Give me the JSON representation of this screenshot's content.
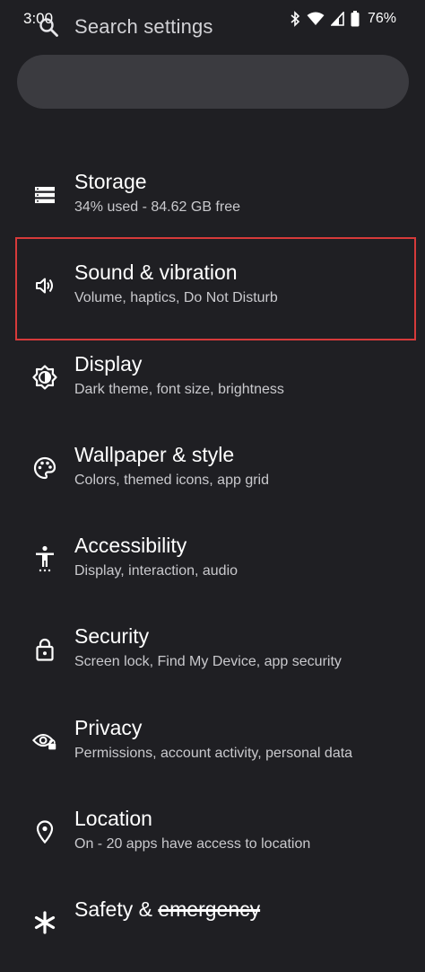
{
  "status_bar": {
    "time": "3:00",
    "battery_percent": "76%"
  },
  "search": {
    "placeholder": "Search settings"
  },
  "settings": [
    {
      "title": "Storage",
      "subtitle": "34% used - 84.62 GB free",
      "icon": "storage-icon"
    },
    {
      "title": "Sound & vibration",
      "subtitle": "Volume, haptics, Do Not Disturb",
      "icon": "sound-icon"
    },
    {
      "title": "Display",
      "subtitle": "Dark theme, font size, brightness",
      "icon": "display-icon"
    },
    {
      "title": "Wallpaper & style",
      "subtitle": "Colors, themed icons, app grid",
      "icon": "palette-icon"
    },
    {
      "title": "Accessibility",
      "subtitle": "Display, interaction, audio",
      "icon": "accessibility-icon"
    },
    {
      "title": "Security",
      "subtitle": "Screen lock, Find My Device, app security",
      "icon": "lock-icon"
    },
    {
      "title": "Privacy",
      "subtitle": "Permissions, account activity, personal data",
      "icon": "privacy-icon"
    },
    {
      "title": "Location",
      "subtitle": "On - 20 apps have access to location",
      "icon": "location-icon"
    }
  ],
  "partial_item": {
    "title_part1": "Safety & ",
    "title_part2": "emergency",
    "icon": "asterisk-icon"
  },
  "colors": {
    "background": "#1f1f23",
    "search_bg": "#3b3b40",
    "highlight": "#d63a3a"
  }
}
